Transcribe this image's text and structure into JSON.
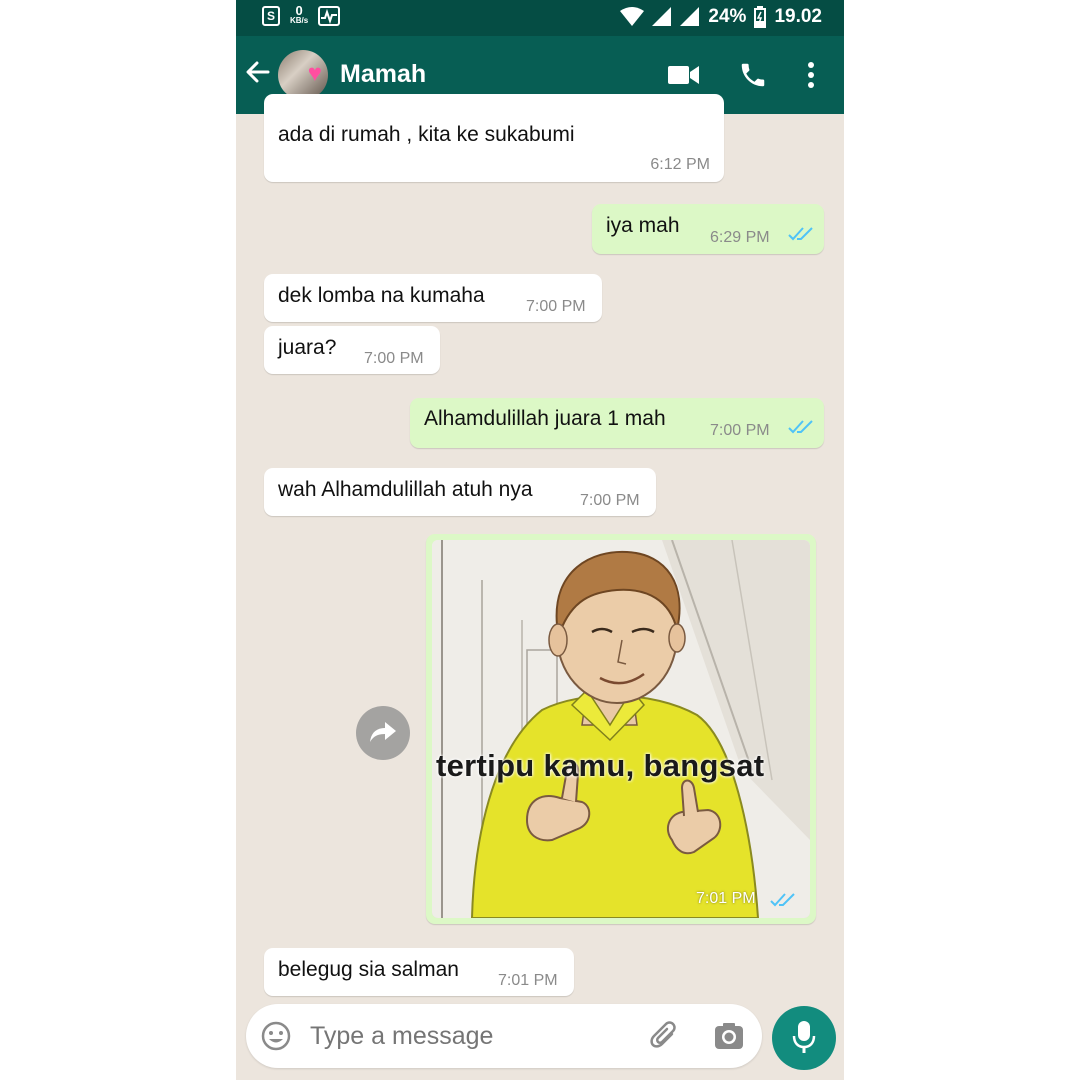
{
  "status_bar": {
    "shop_icon_letter": "S",
    "net_speed_value": "0",
    "net_speed_unit": "KB/s",
    "battery": "24%",
    "time": "19.02"
  },
  "header": {
    "contact_name": "Mamah"
  },
  "messages": [
    {
      "direction": "in",
      "text_line1": "ada di rumah , kita ke sukabumi",
      "time": "6:12 PM"
    },
    {
      "direction": "out",
      "text": "iya mah",
      "time": "6:29 PM",
      "read": true
    },
    {
      "direction": "in",
      "text": "dek lomba na kumaha",
      "time": "7:00 PM"
    },
    {
      "direction": "in",
      "text": "juara?",
      "time": "7:00 PM"
    },
    {
      "direction": "out",
      "text": "Alhamdulillah juara 1 mah",
      "time": "7:00 PM",
      "read": true
    },
    {
      "direction": "in",
      "text": "wah Alhamdulillah atuh nya",
      "time": "7:00 PM"
    },
    {
      "direction": "out",
      "type": "image",
      "caption": "tertipu kamu, bangsat",
      "time": "7:01 PM",
      "read": true
    },
    {
      "direction": "in",
      "text": "belegug sia salman",
      "time": "7:01 PM"
    }
  ],
  "input": {
    "placeholder": "Type a message"
  },
  "colors": {
    "status_bar": "#054d44",
    "app_bar": "#075e54",
    "chat_background": "#ece5dd",
    "outgoing_bubble": "#dcf8c6",
    "incoming_bubble": "#ffffff",
    "read_ticks": "#4fc3f7",
    "mic_button": "#128c7e"
  },
  "icons": {
    "back": "arrow-left-icon",
    "video": "video-camera-icon",
    "call": "phone-icon",
    "menu": "more-vert-icon",
    "forward": "forward-icon",
    "emoji": "emoji-icon",
    "attach": "paperclip-icon",
    "camera": "camera-icon",
    "mic": "microphone-icon"
  }
}
